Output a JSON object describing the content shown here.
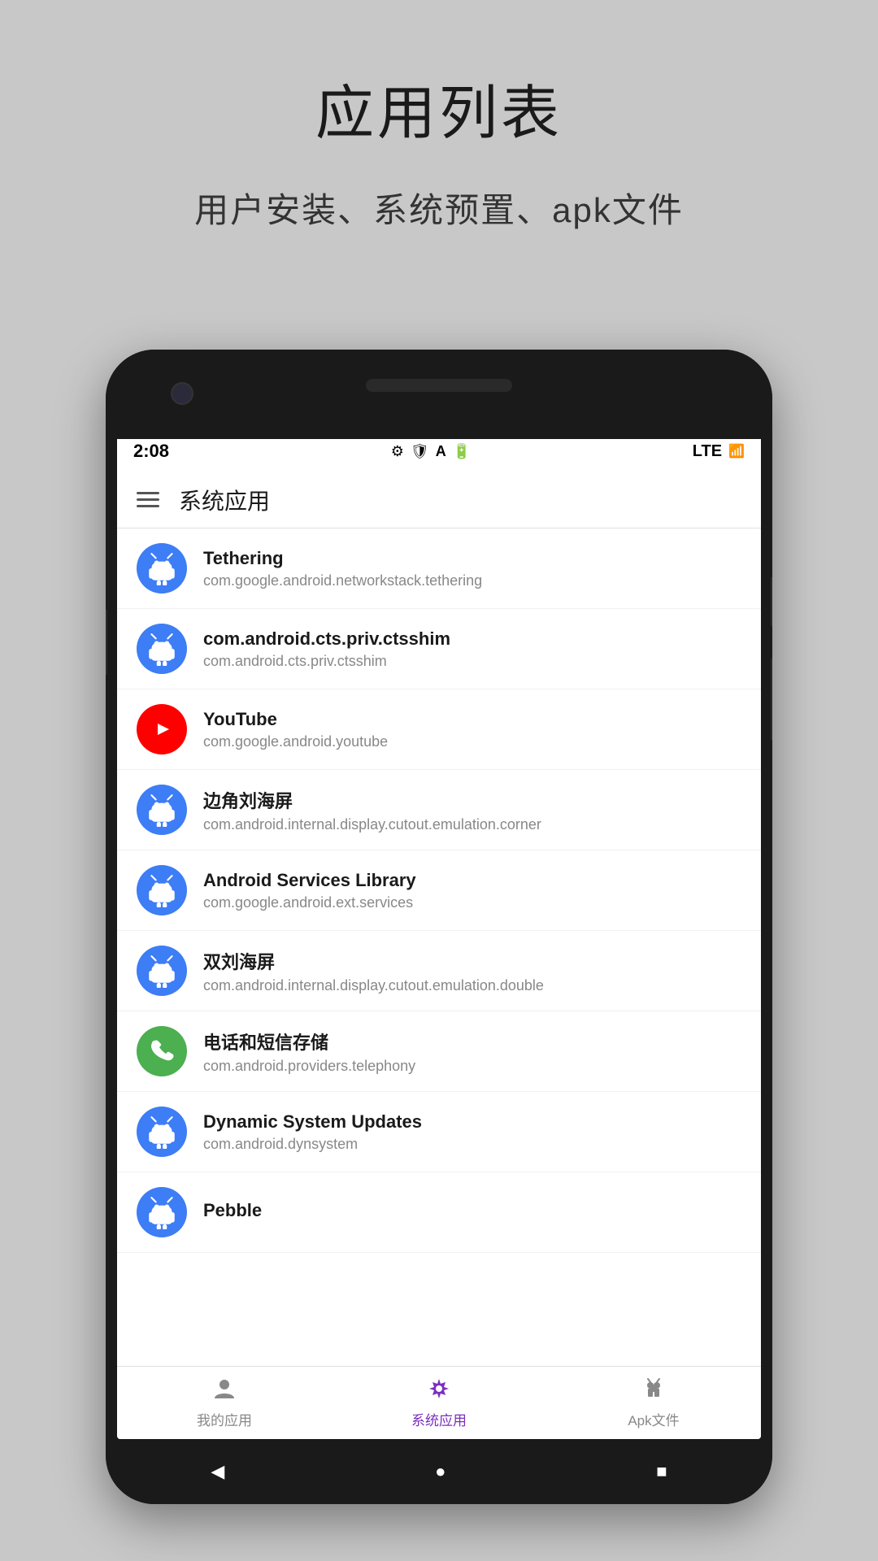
{
  "header": {
    "title": "应用列表",
    "subtitle": "用户安装、系统预置、apk文件"
  },
  "status_bar": {
    "time": "2:08",
    "network": "LTE",
    "icons": [
      "⚙",
      "🛡",
      "A",
      "🔋"
    ]
  },
  "app_bar": {
    "title": "系统应用"
  },
  "apps": [
    {
      "name": "Tethering",
      "package": "com.google.android.networkstack.tethering",
      "icon_type": "android",
      "icon_color": "#3d7df5"
    },
    {
      "name": "com.android.cts.priv.ctsshim",
      "package": "com.android.cts.priv.ctsshim",
      "icon_type": "android",
      "icon_color": "#3d7df5"
    },
    {
      "name": "YouTube",
      "package": "com.google.android.youtube",
      "icon_type": "youtube",
      "icon_color": "#ff0000"
    },
    {
      "name": "边角刘海屏",
      "package": "com.android.internal.display.cutout.emulation.corner",
      "icon_type": "android",
      "icon_color": "#3d7df5"
    },
    {
      "name": "Android Services Library",
      "package": "com.google.android.ext.services",
      "icon_type": "android",
      "icon_color": "#3d7df5"
    },
    {
      "name": "双刘海屏",
      "package": "com.android.internal.display.cutout.emulation.double",
      "icon_type": "android",
      "icon_color": "#3d7df5"
    },
    {
      "name": "电话和短信存储",
      "package": "com.android.providers.telephony",
      "icon_type": "phone",
      "icon_color": "#4caf50"
    },
    {
      "name": "Dynamic System Updates",
      "package": "com.android.dynsystem",
      "icon_type": "android",
      "icon_color": "#3d7df5"
    },
    {
      "name": "Pebble",
      "package": "",
      "icon_type": "android",
      "icon_color": "#3d7df5"
    }
  ],
  "bottom_nav": {
    "items": [
      {
        "label": "我的应用",
        "icon": "person",
        "active": false
      },
      {
        "label": "系统应用",
        "icon": "gear",
        "active": true
      },
      {
        "label": "Apk文件",
        "icon": "android",
        "active": false
      }
    ]
  },
  "phone_nav": {
    "back": "◀",
    "home": "●",
    "recents": "■"
  }
}
